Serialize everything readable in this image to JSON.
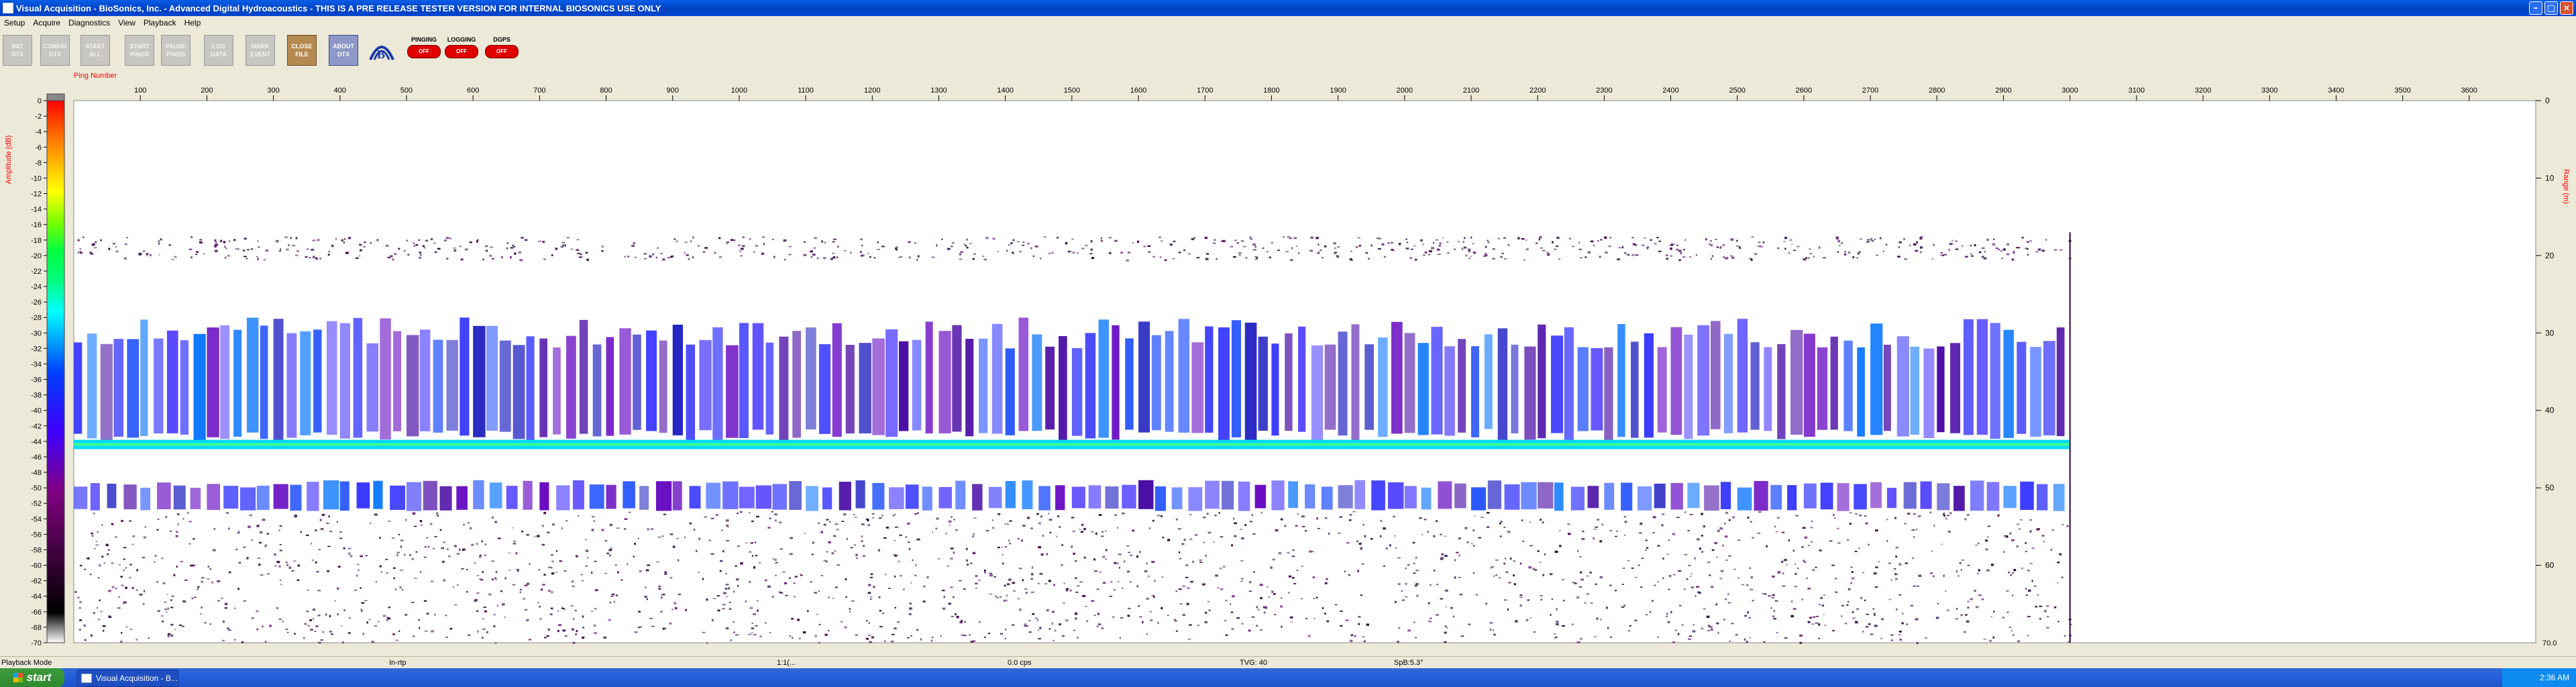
{
  "window": {
    "title": "Visual Acquisition  -  BioSonics, Inc.  -  Advanced Digital Hydroacoustics  -  THIS IS A PRE RELEASE TESTER VERSION FOR INTERNAL BIOSONICS USE ONLY",
    "minimize_icon": "minimize-icon",
    "maximize_icon": "maximize-icon",
    "close_icon": "close-icon"
  },
  "menu": [
    "Setup",
    "Acquire",
    "Diagnostics",
    "View",
    "Playback",
    "Help"
  ],
  "toolbar": {
    "buttons": [
      {
        "label": "INIT\nDTX",
        "state": "disabled"
      },
      {
        "label": "CONFIG\nDTX",
        "state": "disabled"
      },
      {
        "label": "START\nALL",
        "state": "disabled"
      },
      {
        "label": "START\nPINGS",
        "state": "disabled"
      },
      {
        "label": "PAUSE\nPINGS",
        "state": "disabled"
      },
      {
        "label": "LOG\nDATA",
        "state": "disabled"
      },
      {
        "label": "MARK\nEVENT",
        "state": "disabled"
      },
      {
        "label": "CLOSE\nFILE",
        "state": "active"
      },
      {
        "label": "ABOUT\nDTX",
        "state": "about"
      }
    ],
    "logo_icon": "biosonics-logo-icon",
    "indicators": [
      {
        "label": "PINGING",
        "value": "OFF"
      },
      {
        "label": "LOGGING",
        "value": "OFF"
      },
      {
        "label": "DGPS",
        "value": "OFF"
      }
    ]
  },
  "chart_data": {
    "type": "heatmap",
    "xlabel": "Ping Number",
    "ylabel_left": "Amplitude (dB)",
    "ylabel_right": "Range (m)",
    "x_ticks": [
      100,
      200,
      300,
      400,
      500,
      600,
      700,
      800,
      900,
      1000,
      1100,
      1200,
      1300,
      1400,
      1500,
      1600,
      1700,
      1800,
      1900,
      2000,
      2100,
      2200,
      2300,
      2400,
      2500,
      2600,
      2700,
      2800,
      2900,
      3000,
      3100,
      3200,
      3300,
      3400,
      3500,
      3600
    ],
    "xlim": [
      0,
      3700
    ],
    "data_extent_pings": 3000,
    "ylim_range_m": [
      0,
      70
    ],
    "range_ticks": [
      0,
      10,
      20,
      30,
      40,
      50,
      60
    ],
    "range_bottom_label": "70.0",
    "amplitude_ticks": [
      0,
      -2,
      -4,
      -6,
      -8,
      -10,
      -12,
      -14,
      -16,
      -18,
      -20,
      -22,
      -24,
      -26,
      -28,
      -30,
      -32,
      -34,
      -36,
      -38,
      -40,
      -42,
      -44,
      -46,
      -48,
      -50,
      -52,
      -54,
      -56,
      -58,
      -60,
      -62,
      -64,
      -66,
      -68,
      -70
    ],
    "colorbar": [
      "#ff0000",
      "#ff6000",
      "#ffb000",
      "#ffff00",
      "#80ff00",
      "#00ff40",
      "#00ff80",
      "#00ffff",
      "#00a0ff",
      "#0040ff",
      "#2020ff",
      "#4000ff",
      "#6000c0",
      "#800080",
      "#600060",
      "#400040",
      "#200020",
      "#000000",
      "#ffffff"
    ],
    "layers": [
      {
        "name": "surface-scatter",
        "range_m": [
          17.5,
          20.5
        ],
        "level": "weak"
      },
      {
        "name": "scattering-layer",
        "range_m": [
          28,
          44
        ],
        "level": "moderate"
      },
      {
        "name": "strong-reflection",
        "range_m": [
          43.8,
          45.0
        ],
        "level": "strong"
      },
      {
        "name": "secondary-layer",
        "range_m": [
          49,
          53
        ],
        "level": "moderate"
      },
      {
        "name": "background-noise",
        "range_m": [
          53,
          70
        ],
        "level": "weak"
      }
    ]
  },
  "statusbar": {
    "mode": "Playback Mode",
    "fields": [
      "In-rtp",
      "1:1(...",
      "0.0 cps",
      "TVG: 40",
      "SpB:5.3°"
    ]
  },
  "taskbar": {
    "start_label": "start",
    "task_label": "Visual Acquisition - B...",
    "clock": "2:36 AM"
  }
}
